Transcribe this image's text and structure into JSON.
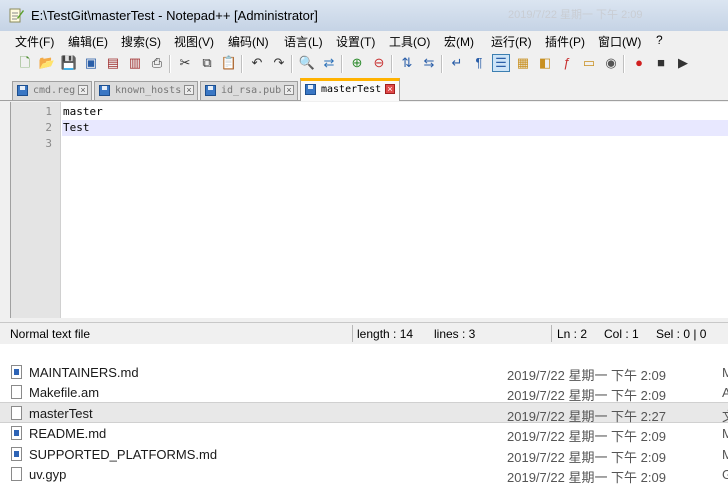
{
  "window": {
    "title": "E:\\TestGit\\masterTest - Notepad++ [Administrator]",
    "background_title": "2019/7/22 星期一 下午 2:09"
  },
  "menu": [
    "文件(F)",
    "编辑(E)",
    "搜索(S)",
    "视图(V)",
    "编码(N)",
    "语言(L)",
    "设置(T)",
    "工具(O)",
    "宏(M)",
    "运行(R)",
    "插件(P)",
    "窗口(W)",
    "?"
  ],
  "toolbar": {
    "buttons": [
      {
        "name": "new-file-icon",
        "glyph": "🗋",
        "color": "#4a8a2a"
      },
      {
        "name": "open-file-icon",
        "glyph": "📂",
        "color": "#c89020"
      },
      {
        "name": "save-icon",
        "glyph": "💾",
        "color": "#2a5ea8"
      },
      {
        "name": "save-all-icon",
        "glyph": "▣",
        "color": "#2a5ea8"
      },
      {
        "name": "close-icon",
        "glyph": "▤",
        "color": "#a03030"
      },
      {
        "name": "close-all-icon",
        "glyph": "▥",
        "color": "#a03030"
      },
      {
        "name": "print-icon",
        "glyph": "⎙",
        "color": "#333333"
      },
      {
        "name": "cut-icon",
        "glyph": "✂",
        "color": "#333333"
      },
      {
        "name": "copy-icon",
        "glyph": "⧉",
        "color": "#333333"
      },
      {
        "name": "paste-icon",
        "glyph": "📋",
        "color": "#8a6a20"
      },
      {
        "name": "undo-icon",
        "glyph": "↶",
        "color": "#333333"
      },
      {
        "name": "redo-icon",
        "glyph": "↷",
        "color": "#333333"
      },
      {
        "name": "find-icon",
        "glyph": "🔍",
        "color": "#333333"
      },
      {
        "name": "replace-icon",
        "glyph": "⇄",
        "color": "#2a70b8"
      },
      {
        "name": "zoom-in-icon",
        "glyph": "⊕",
        "color": "#2a8a2a"
      },
      {
        "name": "zoom-out-icon",
        "glyph": "⊖",
        "color": "#c83030"
      },
      {
        "name": "sync-vertical-icon",
        "glyph": "⇅",
        "color": "#2a5ea8"
      },
      {
        "name": "sync-horizontal-icon",
        "glyph": "⇆",
        "color": "#2a5ea8"
      },
      {
        "name": "word-wrap-icon",
        "glyph": "↵",
        "color": "#2a5ea8"
      },
      {
        "name": "show-all-chars-icon",
        "glyph": "¶",
        "color": "#2a5ea8"
      },
      {
        "name": "indent-guide-icon",
        "glyph": "☰",
        "color": "#2a5ea8",
        "active": true
      },
      {
        "name": "user-lang-icon",
        "glyph": "▦",
        "color": "#c89020"
      },
      {
        "name": "doc-map-icon",
        "glyph": "◧",
        "color": "#c89020"
      },
      {
        "name": "function-list-icon",
        "glyph": "ƒ",
        "color": "#c83030"
      },
      {
        "name": "folder-workspace-icon",
        "glyph": "▭",
        "color": "#c89020"
      },
      {
        "name": "monitoring-icon",
        "glyph": "◉",
        "color": "#555555"
      },
      {
        "name": "record-macro-icon",
        "glyph": "●",
        "color": "#d02020"
      },
      {
        "name": "stop-macro-icon",
        "glyph": "■",
        "color": "#333333"
      },
      {
        "name": "play-macro-icon",
        "glyph": "▶",
        "color": "#333333"
      }
    ]
  },
  "tabs": [
    {
      "label": "cmd.reg",
      "active": false
    },
    {
      "label": "known_hosts",
      "active": false
    },
    {
      "label": "id_rsa.pub",
      "active": false
    },
    {
      "label": "masterTest",
      "active": true
    }
  ],
  "editor": {
    "lines": [
      {
        "number": "1",
        "text": "master"
      },
      {
        "number": "2",
        "text": "Test",
        "current": true
      },
      {
        "number": "3",
        "text": ""
      }
    ]
  },
  "status": {
    "file_type": "Normal text file",
    "length": "length : 14",
    "lines": "lines : 3",
    "ln": "Ln : 2",
    "col": "Col : 1",
    "sel": "Sel : 0 | 0"
  },
  "explorer": {
    "files": [
      {
        "name": "MAINTAINERS.md",
        "date": "2019/7/22 星期一 下午 2:09",
        "type": "M",
        "kind": "md"
      },
      {
        "name": "Makefile.am",
        "date": "2019/7/22 星期一 下午 2:09",
        "type": "A",
        "kind": "plain"
      },
      {
        "name": "masterTest",
        "date": "2019/7/22 星期一 下午 2:27",
        "type": "文",
        "kind": "plain",
        "selected": true
      },
      {
        "name": "README.md",
        "date": "2019/7/22 星期一 下午 2:09",
        "type": "M",
        "kind": "md"
      },
      {
        "name": "SUPPORTED_PLATFORMS.md",
        "date": "2019/7/22 星期一 下午 2:09",
        "type": "M",
        "kind": "md"
      },
      {
        "name": "uv.gyp",
        "date": "2019/7/22 星期一 下午 2:09",
        "type": "G",
        "kind": "plain"
      }
    ]
  }
}
